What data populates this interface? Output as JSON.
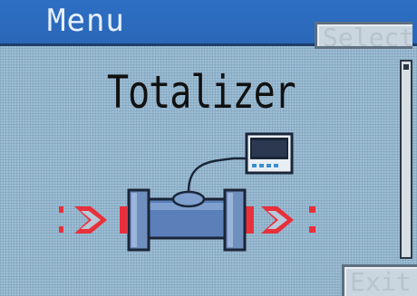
{
  "header": {
    "title": "Menu"
  },
  "softkeys": {
    "select_label": "Select",
    "exit_label": "Exit"
  },
  "main": {
    "heading": "Totalizer"
  },
  "illustration": {
    "name": "pipe-flow-meter-icon",
    "flow_arrow_color": "#e8303a",
    "pipe_color": "#5b7fb8",
    "device_color": "#1a2538"
  },
  "colors": {
    "titlebar": "#2e6fc4",
    "screen": "#9dbdd4",
    "text": "#111111"
  }
}
